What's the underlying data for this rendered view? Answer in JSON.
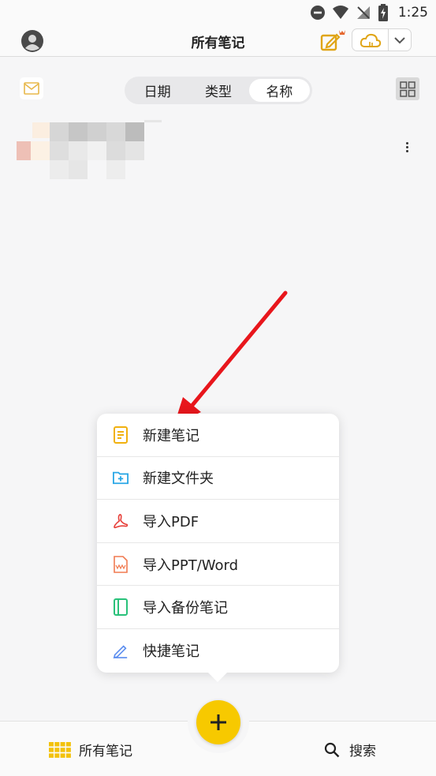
{
  "status_bar": {
    "time": "1:25"
  },
  "header": {
    "title": "所有笔记"
  },
  "sort_tabs": [
    {
      "label": "日期",
      "active": false
    },
    {
      "label": "类型",
      "active": false
    },
    {
      "label": "名称",
      "active": true
    }
  ],
  "menu": {
    "items": [
      {
        "label": "新建笔记",
        "icon": "new-note-icon"
      },
      {
        "label": "新建文件夹",
        "icon": "new-folder-icon"
      },
      {
        "label": "导入PDF",
        "icon": "pdf-icon"
      },
      {
        "label": "导入PPT/Word",
        "icon": "ppt-word-icon"
      },
      {
        "label": "导入备份笔记",
        "icon": "backup-note-icon"
      },
      {
        "label": "快捷笔记",
        "icon": "pen-icon"
      }
    ]
  },
  "bottom_nav": {
    "all_notes_label": "所有笔记",
    "search_label": "搜索"
  },
  "colors": {
    "accent_yellow": "#f7c900",
    "arrow_red": "#e8161c",
    "folder_blue": "#2aa7e6",
    "pdf_red": "#e7403a",
    "backup_green": "#29c17a",
    "pen_blue": "#5b8def"
  }
}
